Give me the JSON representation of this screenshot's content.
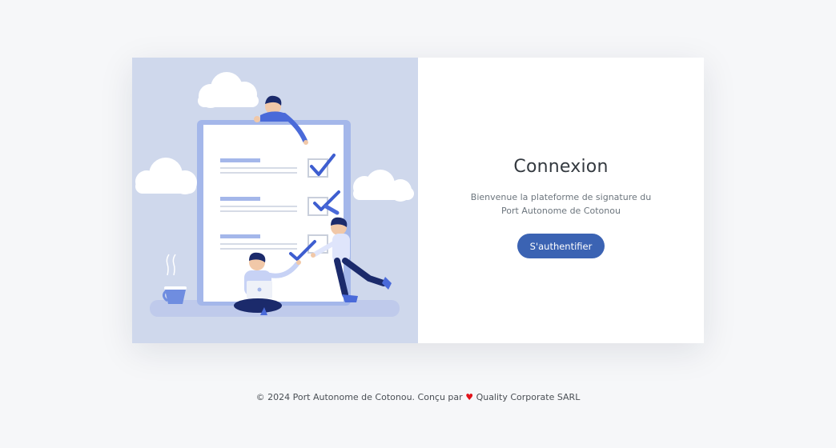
{
  "login": {
    "title": "Connexion",
    "subtitle": "Bienvenue la plateforme de signature du Port Autonome de Cotonou",
    "button_label": "S'authentifier"
  },
  "footer": {
    "prefix": "© 2024 Port Autonome de Cotonou. Conçu par",
    "heart_icon": "heart-icon",
    "company": "Quality Corporate SARL"
  },
  "colors": {
    "page_background": "#f6f7f9",
    "illustration_background": "#cfd8ec",
    "primary_button": "#3b63b3",
    "heart": "#e3131b"
  }
}
